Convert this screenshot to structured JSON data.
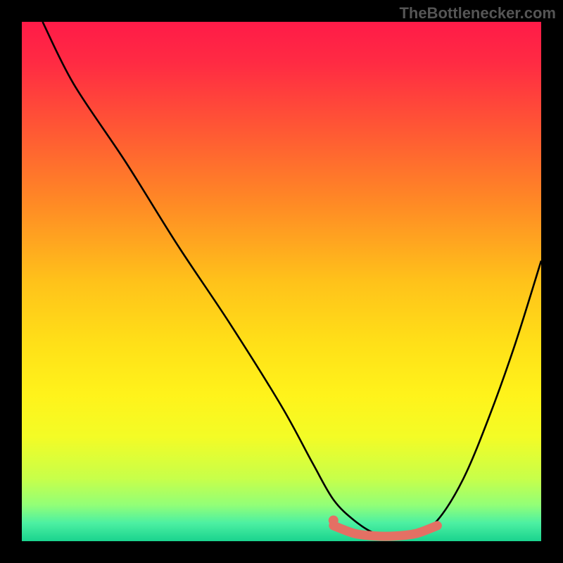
{
  "watermark": "TheBottlenecker.com",
  "chart_data": {
    "type": "line",
    "title": "",
    "xlabel": "",
    "ylabel": "",
    "xlim": [
      0,
      100
    ],
    "ylim": [
      0,
      100
    ],
    "background_gradient_stops": [
      {
        "offset": 0.0,
        "color": "#ff1b48"
      },
      {
        "offset": 0.08,
        "color": "#ff2b43"
      },
      {
        "offset": 0.2,
        "color": "#ff5535"
      },
      {
        "offset": 0.35,
        "color": "#ff8a25"
      },
      {
        "offset": 0.5,
        "color": "#ffc21a"
      },
      {
        "offset": 0.62,
        "color": "#ffe018"
      },
      {
        "offset": 0.72,
        "color": "#fff31b"
      },
      {
        "offset": 0.8,
        "color": "#f3fc26"
      },
      {
        "offset": 0.88,
        "color": "#c7ff4a"
      },
      {
        "offset": 0.93,
        "color": "#93ff77"
      },
      {
        "offset": 0.965,
        "color": "#4cf0a2"
      },
      {
        "offset": 1.0,
        "color": "#1ad38e"
      }
    ],
    "series": [
      {
        "name": "bottleneck-curve",
        "color": "#000000",
        "x": [
          4,
          10,
          20,
          30,
          40,
          50,
          56,
          60,
          64,
          68,
          72,
          76,
          80,
          85,
          90,
          95,
          100
        ],
        "y": [
          100,
          88,
          73,
          57,
          42,
          26,
          15,
          8,
          4,
          1.5,
          1,
          1.5,
          4,
          12,
          24,
          38,
          54
        ]
      },
      {
        "name": "optimal-range-highlight",
        "color": "#e47064",
        "x": [
          60,
          64,
          68,
          72,
          76,
          80
        ],
        "y": [
          3,
          1.5,
          1,
          1,
          1.5,
          3
        ]
      }
    ],
    "highlight_marker": {
      "x": 60,
      "y": 4,
      "color": "#e47064"
    }
  }
}
